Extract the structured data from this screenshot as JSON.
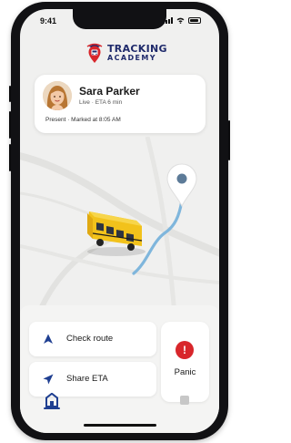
{
  "status_bar": {
    "time": "9:41"
  },
  "brand": {
    "word1": "TRACKING",
    "word2": "ACADEMY",
    "color": "#1f2a6b"
  },
  "student": {
    "name": "Sara Parker",
    "live_eta": "Live · ETA 6 min",
    "status": "Present · Marked at 8:05 AM"
  },
  "actions": {
    "check_route": "Check route",
    "share_eta": "Share ETA",
    "panic": "Panic"
  },
  "colors": {
    "accent": "#1f3f91",
    "panic": "#d8262b",
    "route": "#7fb6dc",
    "bus": "#f2c21b"
  },
  "icons": {
    "check_route": "navigation-arrow-icon",
    "share_eta": "send-arrow-icon",
    "panic": "alert-icon",
    "tab_home": "home-icon",
    "tab_other": "square-icon"
  }
}
